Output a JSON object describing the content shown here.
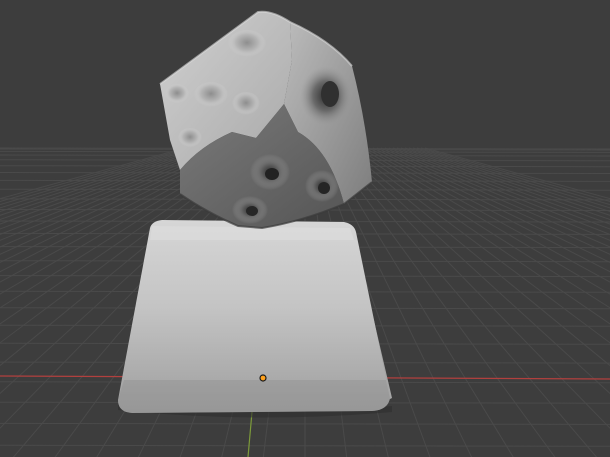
{
  "viewport": {
    "background_color": "#3d3d3d",
    "grid_line_color": "#4a4a4a",
    "x_axis_color": "#b2403e",
    "y_axis_color": "#7d9b3a",
    "origin_marker_color": "#ffa11c",
    "icons": [
      "origin-point-icon"
    ]
  },
  "scene": {
    "objects": [
      {
        "name": "keycap-base",
        "material_color": "#bdbdbd"
      },
      {
        "name": "sculpted-dice-cube",
        "material_color": "#c4c4c4"
      }
    ]
  }
}
